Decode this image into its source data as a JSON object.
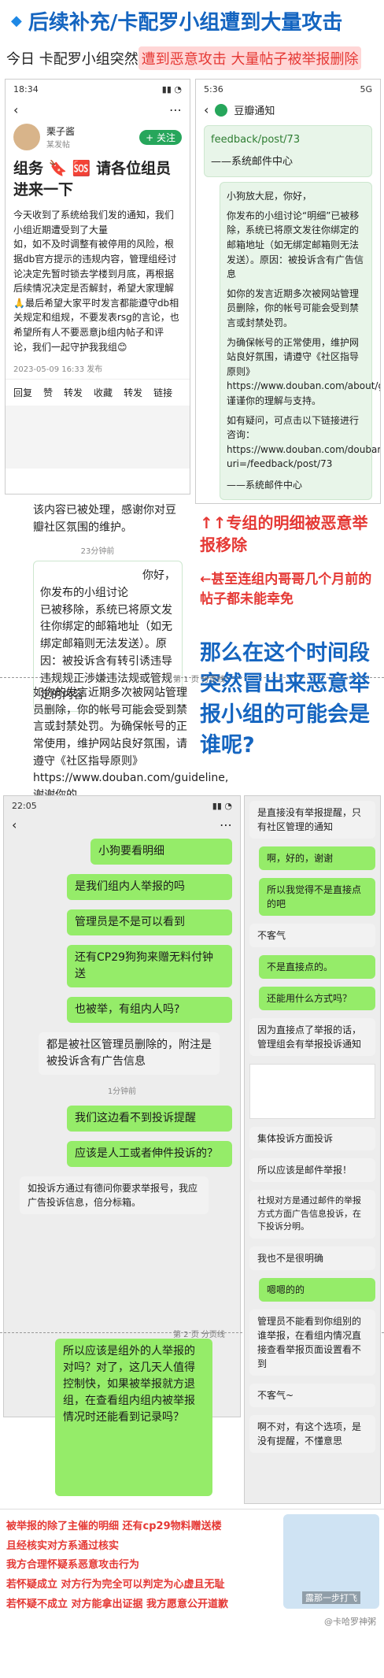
{
  "header": {
    "diamond": "◆",
    "title": "后续补充/卡配罗小组遭到大量攻击",
    "subtitle_prefix": "今日 卡配罗小组突然",
    "subtitle_highlight": "遭到恶意攻击 大量帖子被举报删除"
  },
  "shot1": {
    "time": "18:34",
    "user": "栗子酱",
    "user_meta": "牛门场",
    "post_time_hint": "某发帖",
    "follow": "+ 关注",
    "post_title": "组务 🔖 🆘 请各位组员进来一下",
    "body": "今天收到了系统给我们发的通知，我们小组近期遭受到了大量\n如，如不及时调整有被停用的风险，根据db官方提示的违规内容，管理组经讨论决定先暂时锁去学楼到月底，再根据后续情况决定是否解封，希望大家理解🙏最后希望大家平时发言都能遵守db相关规定和组规，不要发表rsg的言论，也希望所有人不要恶意jb组内帖子和评论，我们一起守护我我组😊",
    "meta": "2023-05-09 16:33 发布",
    "tabs": [
      "回复",
      "赞",
      "转发",
      "收藏",
      "转发",
      "链接"
    ],
    "footer_hint": "第1 页 分页线",
    "bottom_text": "该内容已被处理，感谢你对豆瓣社区氛围的维护。",
    "time2": "23分钟前"
  },
  "shot2": {
    "time": "5:36",
    "signal": "5G",
    "app": "豆瓣通知",
    "link_top": "feedback/post/73",
    "system": "——系统邮件中心",
    "greet": "小狗放大屁，你好，",
    "body1": "你发布的小组讨论“明细”已被移除，系统已将原文发往你绑定的邮箱地址（如无绑定邮箱则无法发送）。原因：被投诉含有广告信息",
    "body2": "如你的发言近期多次被网站管理员删除，你的帐号可能会受到禁言或封禁处罚。",
    "body3": "为确保帐号的正常使用，维护网站良好氛围，请遵守《社区指导原则》https://www.douban.com/about/guideline，谨谨你的理解与支持。",
    "body4": "如有疑问，可点击以下链接进行咨询：https://www.douban.com/doubanapp/dispatch?uri=/feedback/post/73",
    "system2": "——系统邮件中心"
  },
  "shot3": {
    "greet": "你好，",
    "body1": "你发布的小组讨论",
    "body1b": "已被移除，系统已将原文发往你绑定的邮箱地址（如无绑定邮箱则无法发送）。原因：被投诉含有转引诱违导违规规正涉嫌违法规或管规定的内容",
    "body2": "如你的发言近期多次被网站管理员删除，你的帐号可能会受到禁言或封禁处罚。为确保帐号的正常使用，维护网站良好氛围，请遵守《社区指导原则》https://www.douban.com/guideline, 谢谢你的"
  },
  "notes": {
    "n1": "↑↑专组的明细被恶意举报移除",
    "n2": "←甚至连组内哥哥几个月前的帖子都未能幸免",
    "n3": "那么在这个时间段突然冒出来恶意举报小组的可能会是谁呢?",
    "page2": "第 1 页 分页线",
    "page3": "第 2 页 分页线"
  },
  "chat_left": {
    "time": "22:05",
    "messages": [
      "小狗要看明细",
      "是我们组内人举报的吗",
      "管理员是不是可以看到",
      "还有CP29狗狗来赠无料付钟送",
      "也被举，有组内人吗?",
      "都是被社区管理员删除的，附注是被投诉含有广告信息",
      "我们这边看不到投诉提醒",
      "应该是人工或者伸件投诉的？",
      "如投诉方通过有德问你要求举报号，我应广告投诉信息，倍分标箱。",
      "所以应该是组外的人举报的对吗？对了，这几天人值得控制快，如果被举报就方退组，在查看组内组内被举报情况时还能看到记录吗？"
    ],
    "time_mid": "1分钟前"
  },
  "chat_right": {
    "messages": [
      "是直接没有举报提醒，只有社区管理的通知",
      "啊，好的，谢谢",
      "所以我觉得不是直接点的吧",
      "不客气",
      "不是直接点的。",
      "还能用什么方式吗？",
      "因为直接点了举报的话，管理组会有举报投诉通知",
      "集体投诉方面投诉",
      "所以应该是邮件举报！",
      "社规对方是通过邮件的举报方式方面广告信息投诉，在下投诉分明。",
      "我也不是很明确",
      "嗯嗯的的",
      "管理员不能看到你组别的谁举报，在看组内情况直接查看举报页面设置看不到",
      "不客气~",
      "啊不对，有这个选项，是没有提醒，不懂意思"
    ]
  },
  "footer": {
    "lines": [
      "被举报的除了主催的明细 还有cp29物料赠送楼",
      "且经核实对方系通过核实",
      "我方合理怀疑系恶意攻击行为",
      "若怀疑成立 对方行为完全可以判定为心虚且无耻",
      "若怀疑不成立 对方能拿出证据 我方愿意公开道歉"
    ],
    "watermark": "@卡哈罗神粥",
    "sticker_text": "露那一步打飞"
  },
  "colors": {
    "brand": "#1565c0",
    "red": "#e53935",
    "green_msg": "#95ec69",
    "douban": "#26a65b"
  }
}
